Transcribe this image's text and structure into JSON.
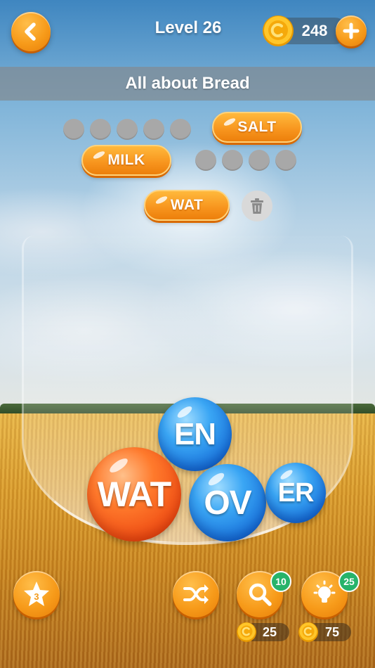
{
  "header": {
    "level_title": "Level 26",
    "coins": "248"
  },
  "category": {
    "title": "All about Bread"
  },
  "words": {
    "hidden_1": {
      "letters": 5
    },
    "found_1": "SALT",
    "found_2": "MILK",
    "hidden_2": {
      "letters": 4
    },
    "current_input": "WAT"
  },
  "bubbles": [
    {
      "text": "EN",
      "color": "blue"
    },
    {
      "text": "WAT",
      "color": "orange"
    },
    {
      "text": "OV",
      "color": "blue"
    },
    {
      "text": "ER",
      "color": "blue"
    }
  ],
  "toolbar": {
    "star_count": "3",
    "search_badge": "10",
    "hint_badge": "25",
    "search_cost": "25",
    "hint_cost": "75"
  },
  "colors": {
    "accent_orange": "#f7941d",
    "bubble_blue": "#1a74dc",
    "bubble_orange": "#ef4d14",
    "badge_green": "#27b36a"
  },
  "icons": [
    "back-arrow-icon",
    "coin-icon",
    "plus-icon",
    "trash-icon",
    "star-icon",
    "shuffle-icon",
    "magnifier-icon",
    "lightbulb-icon"
  ]
}
